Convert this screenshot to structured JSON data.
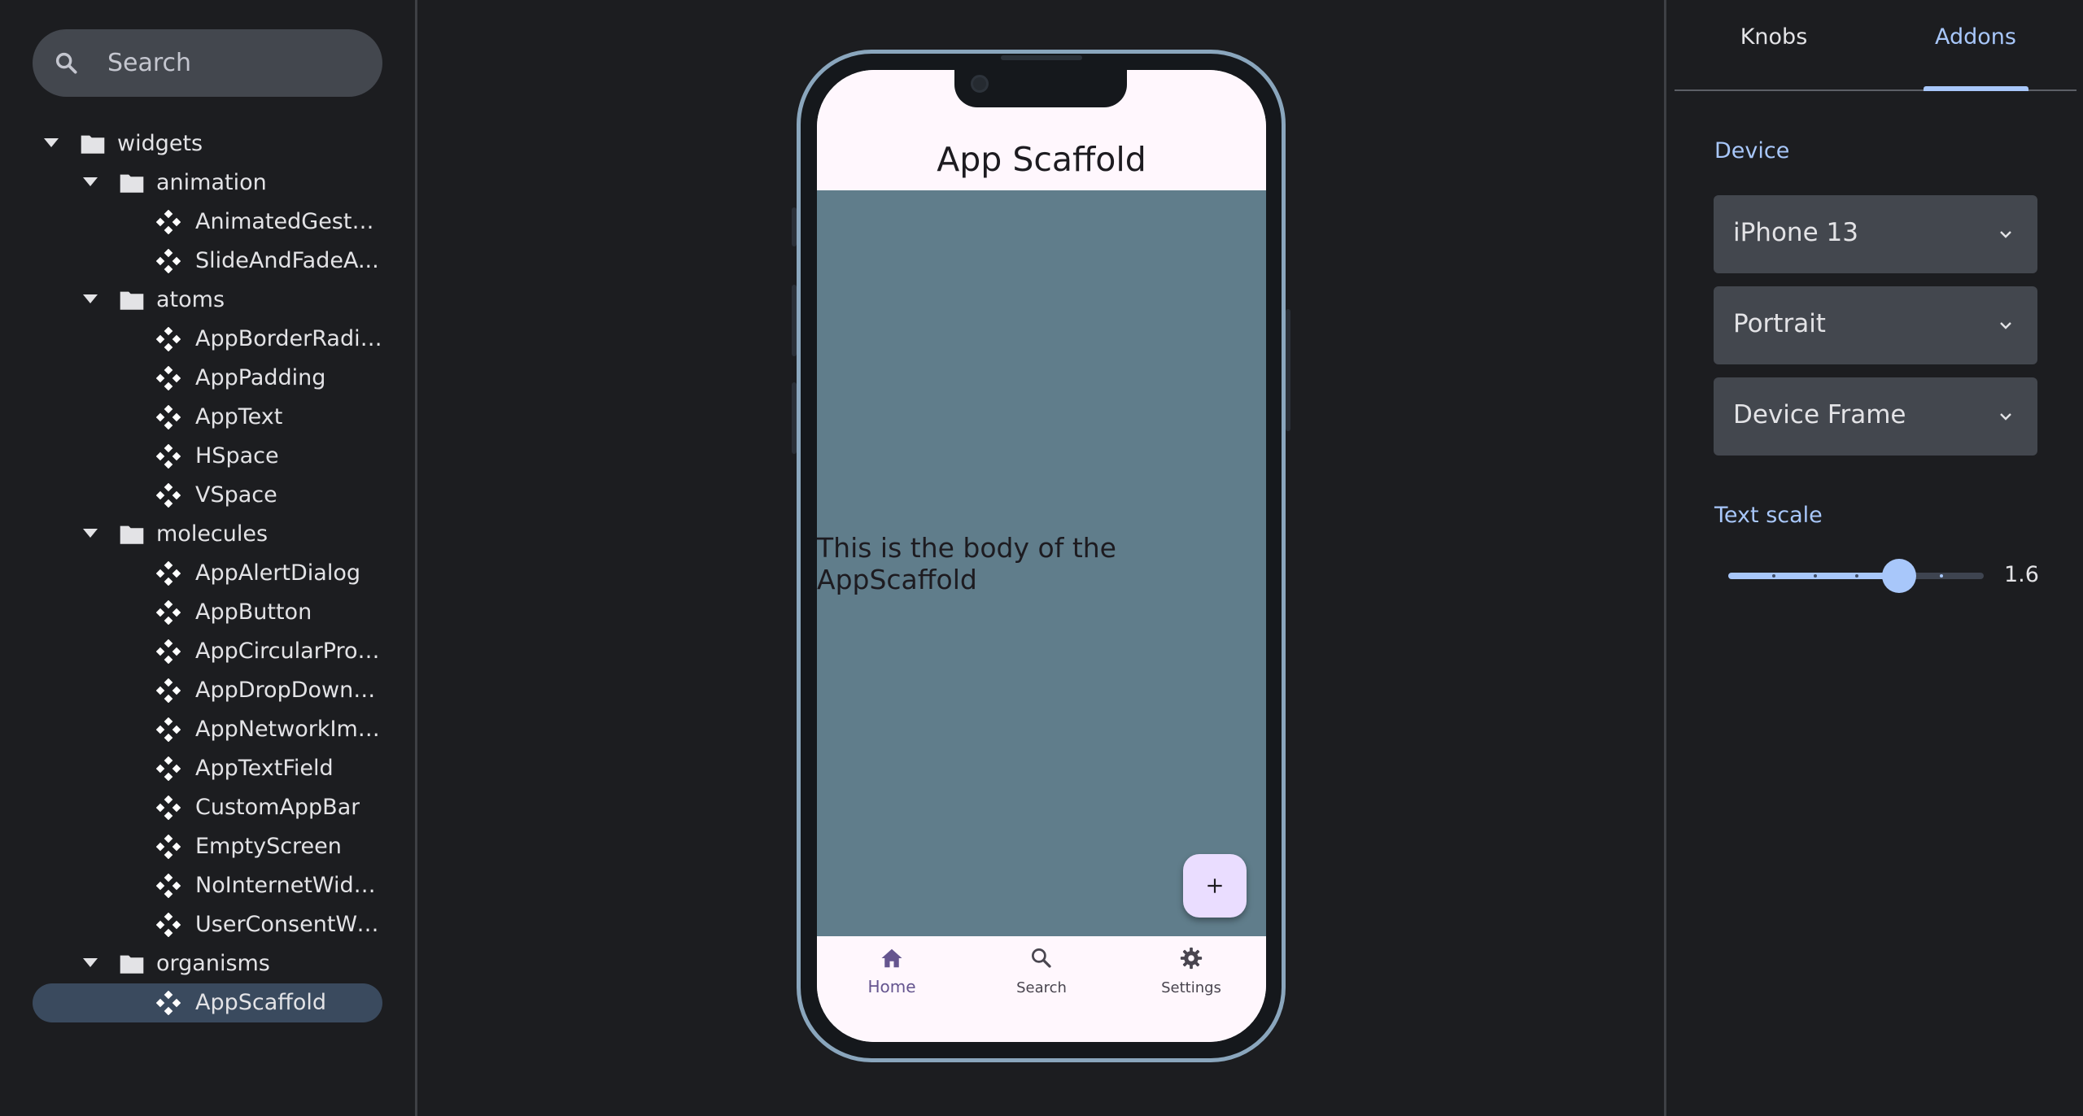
{
  "sidebar": {
    "search_placeholder": "Search",
    "tree": [
      {
        "type": "folder",
        "level": 0,
        "label": "widgets"
      },
      {
        "type": "folder",
        "level": 1,
        "label": "animation"
      },
      {
        "type": "component",
        "level": 2,
        "label": "AnimatedGestur..."
      },
      {
        "type": "component",
        "level": 2,
        "label": "SlideAndFadeA..."
      },
      {
        "type": "folder",
        "level": 1,
        "label": "atoms"
      },
      {
        "type": "component",
        "level": 2,
        "label": "AppBorderRadius"
      },
      {
        "type": "component",
        "level": 2,
        "label": "AppPadding"
      },
      {
        "type": "component",
        "level": 2,
        "label": "AppText"
      },
      {
        "type": "component",
        "level": 2,
        "label": "HSpace"
      },
      {
        "type": "component",
        "level": 2,
        "label": "VSpace"
      },
      {
        "type": "folder",
        "level": 1,
        "label": "molecules"
      },
      {
        "type": "component",
        "level": 2,
        "label": "AppAlertDialog"
      },
      {
        "type": "component",
        "level": 2,
        "label": "AppButton"
      },
      {
        "type": "component",
        "level": 2,
        "label": "AppCircularProg..."
      },
      {
        "type": "component",
        "level": 2,
        "label": "AppDropDownW..."
      },
      {
        "type": "component",
        "level": 2,
        "label": "AppNetworkIma..."
      },
      {
        "type": "component",
        "level": 2,
        "label": "AppTextField"
      },
      {
        "type": "component",
        "level": 2,
        "label": "CustomAppBar"
      },
      {
        "type": "component",
        "level": 2,
        "label": "EmptyScreen"
      },
      {
        "type": "component",
        "level": 2,
        "label": "NoInternetWidget"
      },
      {
        "type": "component",
        "level": 2,
        "label": "UserConsentWi..."
      },
      {
        "type": "folder",
        "level": 1,
        "label": "organisms"
      },
      {
        "type": "component",
        "level": 2,
        "label": "AppScaffold",
        "selected": true
      }
    ]
  },
  "preview": {
    "app_title": "App Scaffold",
    "body_text": "This is the body of the AppScaffold",
    "fab_icon": "add-icon",
    "nav": [
      {
        "label": "Home",
        "icon": "home-icon",
        "active": true
      },
      {
        "label": "Search",
        "icon": "search-icon",
        "active": false
      },
      {
        "label": "Settings",
        "icon": "gear-icon",
        "active": false
      }
    ]
  },
  "panel": {
    "tabs": [
      "Knobs",
      "Addons"
    ],
    "active_tab": "Addons",
    "device_section": "Device",
    "device_value": "iPhone 13",
    "orientation_value": "Portrait",
    "frame_value": "Device Frame",
    "text_scale_section": "Text scale",
    "text_scale_value": "1.6",
    "text_scale_fraction": 0.6
  },
  "colors": {
    "background": "#1c1d20",
    "accent": "#a8c7fa",
    "app_body": "#607d8b",
    "fab": "#eaddff",
    "nav_active": "#65558f"
  }
}
